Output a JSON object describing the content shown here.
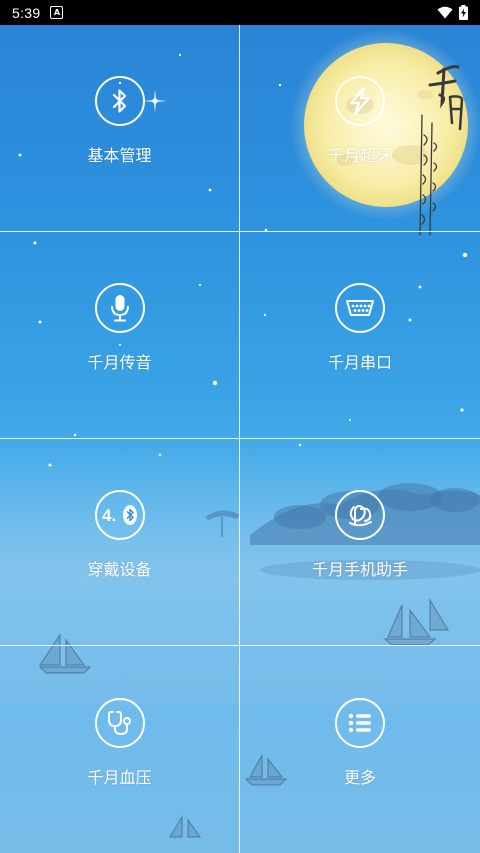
{
  "status_bar": {
    "time": "5:39",
    "notification_icon": "a-box-icon",
    "wifi_icon": "wifi-icon",
    "battery_icon": "battery-charging-icon"
  },
  "menu": {
    "items": [
      {
        "label": "基本管理",
        "icon": "bluetooth-icon"
      },
      {
        "label": "千月超牙",
        "icon": "lightning-icon"
      },
      {
        "label": "千月传音",
        "icon": "microphone-icon"
      },
      {
        "label": "千月串口",
        "icon": "serial-port-icon"
      },
      {
        "label": "穿戴设备",
        "icon": "bluetooth-4-icon",
        "icon_text": "4."
      },
      {
        "label": "千月手机助手",
        "icon": "phone-assistant-logo-icon"
      },
      {
        "label": "千月血压",
        "icon": "stethoscope-icon"
      },
      {
        "label": "更多",
        "icon": "list-icon"
      }
    ]
  },
  "background": {
    "moon_calligraphy": "千月 千江有水千江月"
  }
}
